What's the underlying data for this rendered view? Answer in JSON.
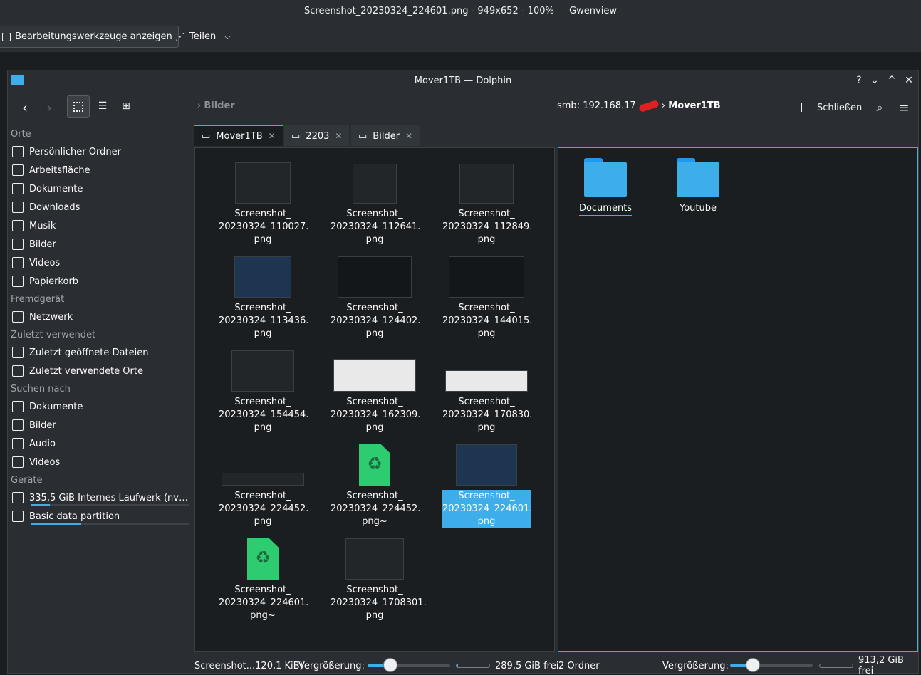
{
  "outer": {
    "title": "Screenshot_20230324_224601.png - 949x652 - 100% — Gwenview",
    "edit_tools_label": "Bearbeitungswerkzeuge anzeigen",
    "share_label": "Teilen"
  },
  "window": {
    "title": "Mover1TB — Dolphin",
    "controls": [
      "?",
      "⌄",
      "^",
      "✕"
    ]
  },
  "toolbar": {
    "left_crumb": "Bilder",
    "path_prefix": "smb: 192.168.17",
    "path_current": "Mover1TB",
    "close_label": "Schließen"
  },
  "sidebar": {
    "sections": [
      {
        "title": "Orte",
        "items": [
          {
            "label": "Persönlicher Ordner",
            "icon": "home-icon"
          },
          {
            "label": "Arbeitsfläche",
            "icon": "desktop-icon"
          },
          {
            "label": "Dokumente",
            "icon": "documents-icon"
          },
          {
            "label": "Downloads",
            "icon": "downloads-icon"
          },
          {
            "label": "Musik",
            "icon": "music-icon"
          },
          {
            "label": "Bilder",
            "icon": "pictures-icon"
          },
          {
            "label": "Videos",
            "icon": "videos-icon"
          },
          {
            "label": "Papierkorb",
            "icon": "trash-icon"
          }
        ]
      },
      {
        "title": "Fremdgerät",
        "items": [
          {
            "label": "Netzwerk",
            "icon": "network-icon"
          }
        ]
      },
      {
        "title": "Zuletzt verwendet",
        "items": [
          {
            "label": "Zuletzt geöffnete Dateien",
            "icon": "recent-files-icon"
          },
          {
            "label": "Zuletzt verwendete Orte",
            "icon": "recent-places-icon"
          }
        ]
      },
      {
        "title": "Suchen nach",
        "items": [
          {
            "label": "Dokumente",
            "icon": "search-documents-icon"
          },
          {
            "label": "Bilder",
            "icon": "search-pictures-icon"
          },
          {
            "label": "Audio",
            "icon": "search-audio-icon"
          },
          {
            "label": "Videos",
            "icon": "search-videos-icon"
          }
        ]
      },
      {
        "title": "Geräte",
        "items": [
          {
            "label": "335,5 GiB Internes Laufwerk (nvm...",
            "icon": "drive-icon",
            "usage": 0.12
          },
          {
            "label": "Basic data partition",
            "icon": "drive-icon",
            "usage": 0.32
          }
        ]
      }
    ]
  },
  "tabs": [
    {
      "label": "Mover1TB",
      "active": true
    },
    {
      "label": "2203",
      "active": false
    },
    {
      "label": "Bilder",
      "active": false
    }
  ],
  "left_pane": {
    "files": [
      {
        "l1": "Screenshot_",
        "l2": "20230324_110027.",
        "l3": "png",
        "kind": "thumb"
      },
      {
        "l1": "Screenshot_",
        "l2": "20230324_112641.",
        "l3": "png",
        "kind": "thumb"
      },
      {
        "l1": "Screenshot_",
        "l2": "20230324_112849.",
        "l3": "png",
        "kind": "thumb"
      },
      {
        "l1": "Screenshot_",
        "l2": "20230324_113436.",
        "l3": "png",
        "kind": "thumb"
      },
      {
        "l1": "Screenshot_",
        "l2": "20230324_124402.",
        "l3": "png",
        "kind": "thumb"
      },
      {
        "l1": "Screenshot_",
        "l2": "20230324_144015.",
        "l3": "png",
        "kind": "thumb"
      },
      {
        "l1": "Screenshot_",
        "l2": "20230324_154454.",
        "l3": "png",
        "kind": "thumb"
      },
      {
        "l1": "Screenshot_",
        "l2": "20230324_162309.",
        "l3": "png",
        "kind": "thumb"
      },
      {
        "l1": "Screenshot_",
        "l2": "20230324_170830.",
        "l3": "png",
        "kind": "thumb"
      },
      {
        "l1": "Screenshot_",
        "l2": "20230324_224452.",
        "l3": "png",
        "kind": "thumb"
      },
      {
        "l1": "Screenshot_",
        "l2": "20230324_224452.",
        "l3": "png~",
        "kind": "trash"
      },
      {
        "l1": "Screenshot_",
        "l2": "20230324_224601.",
        "l3": "png",
        "kind": "thumb",
        "selected": true
      },
      {
        "l1": "Screenshot_",
        "l2": "20230324_224601.",
        "l3": "png~",
        "kind": "trash"
      },
      {
        "l1": "Screenshot_",
        "l2": "20230324_1708301.",
        "l3": "png",
        "kind": "thumb"
      }
    ],
    "status": "Screenshot...120,1 KiB)",
    "zoom_label": "Vergrößerung:",
    "free": "289,5 GiB frei",
    "free_fraction": 0.05,
    "zoom_level": 0.28
  },
  "right_pane": {
    "folders": [
      {
        "label": "Documents"
      },
      {
        "label": "Youtube"
      }
    ],
    "status": "2 Ordner",
    "zoom_label": "Vergrößerung:",
    "free": "913,2 GiB frei",
    "zoom_level": 0.28
  },
  "colors": {
    "accent": "#3daee9",
    "background": "#1b1e20",
    "trash_green": "#2ecc71"
  }
}
